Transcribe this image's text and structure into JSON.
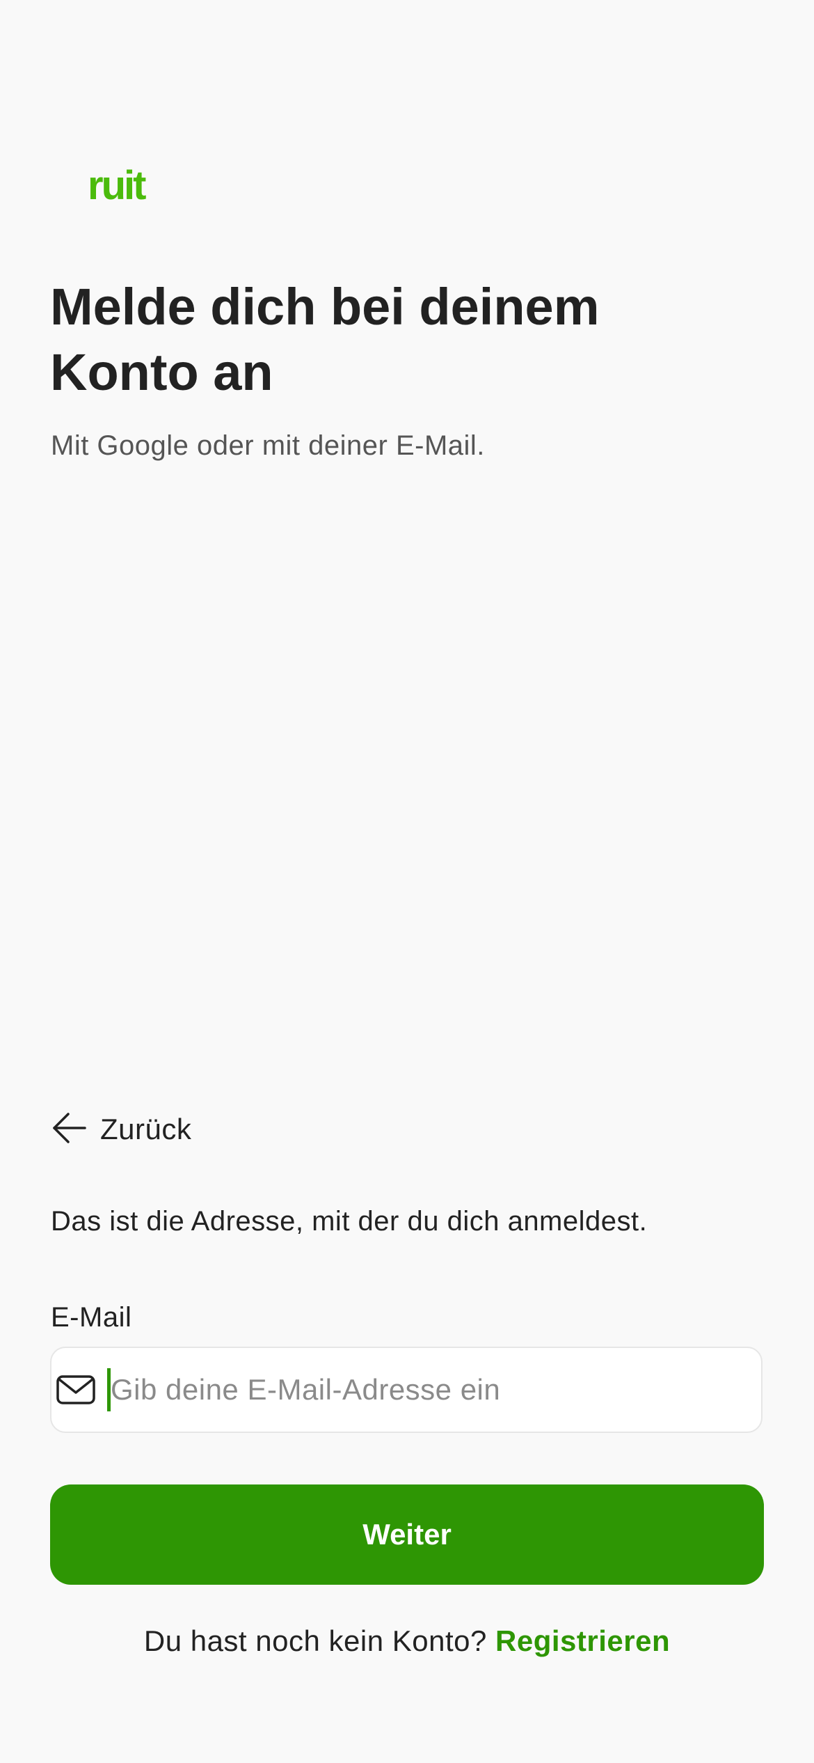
{
  "brand": {
    "logo_text": "ruit",
    "accent_color": "#4bbb0c",
    "primary_color": "#2e9604"
  },
  "header": {
    "title": "Melde dich bei deinem Konto an",
    "subtitle": "Mit Google oder mit deiner E-Mail."
  },
  "back": {
    "label": "Zurück",
    "icon": "arrow-left-icon"
  },
  "form": {
    "helper_text": "Das ist die Adresse, mit der du dich anmeldest.",
    "email_label": "E-Mail",
    "email_placeholder": "Gib deine E-Mail-Adresse ein",
    "email_value": "",
    "email_icon": "mail-icon",
    "submit_label": "Weiter"
  },
  "footer": {
    "prompt": "Du hast noch kein Konto?",
    "link_label": "Registrieren"
  }
}
